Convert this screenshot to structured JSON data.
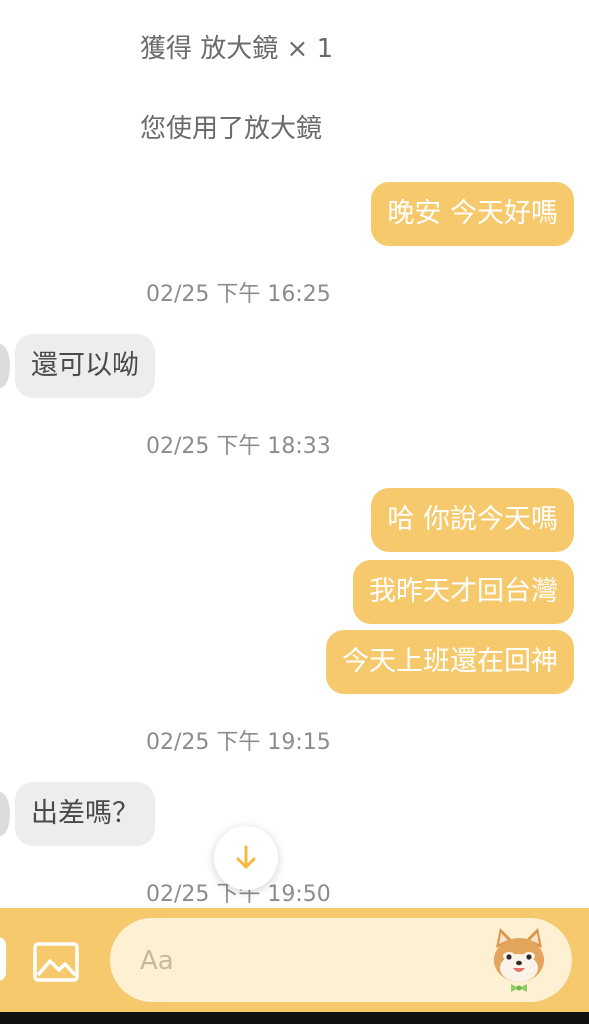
{
  "system_messages": [
    "獲得 放大鏡 × 1",
    "您使用了放大鏡"
  ],
  "messages": {
    "m1": "晚安 今天好嗎",
    "t1": "02/25 下午 16:25",
    "m2": "還可以呦",
    "t2": "02/25 下午 18:33",
    "m3": "哈 你說今天嗎",
    "m4": "我昨天才回台灣",
    "m5": "今天上班還在回神",
    "t3": "02/25 下午 19:15",
    "m6": "出差嗎？",
    "t4": "02/25 下午 19:50"
  },
  "input": {
    "placeholder": "Aa",
    "value": ""
  },
  "icons": {
    "image": "image-icon",
    "scroll": "arrow-down-icon",
    "sticker": "shiba-sticker-icon"
  },
  "colors": {
    "accent": "#f5c96c",
    "outgoing_text": "#ffffff",
    "incoming_bg": "#ededed",
    "input_bg": "#fdf0d3"
  }
}
